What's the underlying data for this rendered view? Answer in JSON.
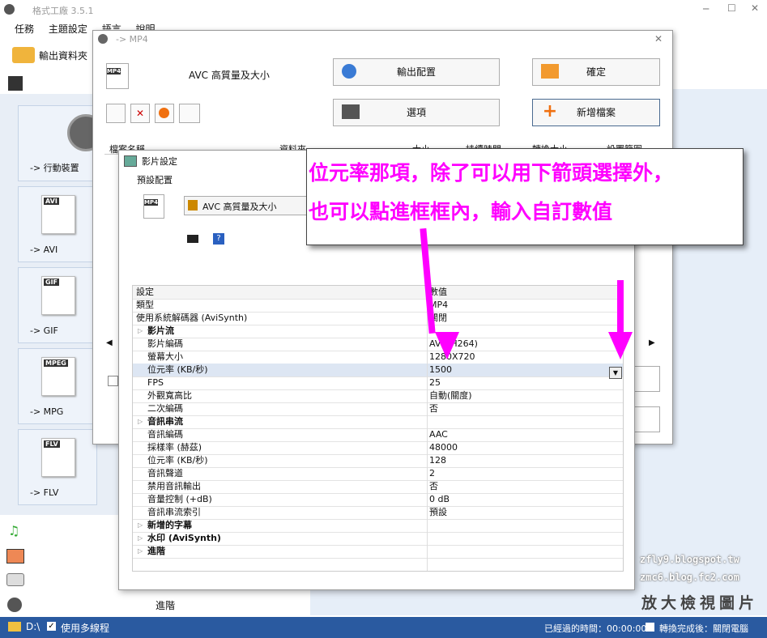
{
  "main_window": {
    "title": "格式工廠 3.5.1",
    "menu": [
      "任務",
      "主題設定",
      "語言",
      "說明"
    ],
    "output_folder_label": "輸出資料夾",
    "side_buttons": [
      {
        "label": "-> 行動裝置",
        "tag": ""
      },
      {
        "label": "-> AVI",
        "tag": "AVI"
      },
      {
        "label": "-> GIF",
        "tag": "GIF"
      },
      {
        "label": "-> MPG",
        "tag": "MPEG"
      },
      {
        "label": "-> FLV",
        "tag": "FLV"
      }
    ],
    "advanced_label": "進階",
    "status": {
      "drive": "D:\\",
      "multithread_label": "使用多線程",
      "elapsed_label": "已經過的時間：00:00:00",
      "after_convert_label": "轉換完成後：關閉電腦"
    }
  },
  "mp4_dialog": {
    "title": "-> MP4",
    "profile": "AVC 高質量及大小",
    "output_config_btn": "輸出配置",
    "ok_btn": "確定",
    "options_btn": "選項",
    "add_file_btn": "新增檔案",
    "mp4_tag": "MP4",
    "columns": [
      "檔案名稱",
      "資料夾",
      "大小",
      "持續時間",
      "轉換大小",
      "設置範圍"
    ]
  },
  "video_settings": {
    "title": "影片設定",
    "preset_label": "預設配置",
    "preset_value": "AVC 高質量及大小",
    "mp4_tag": "MP4",
    "help_glyph": "?",
    "header": {
      "name": "設定",
      "value": "數值"
    },
    "rows": [
      {
        "name": "類型",
        "value": "MP4",
        "kind": "item",
        "indent": 0
      },
      {
        "name": "使用系統解碼器 (AviSynth)",
        "value": "關閉",
        "kind": "item",
        "indent": 0
      },
      {
        "name": "影片流",
        "value": "",
        "kind": "cat",
        "indent": 0
      },
      {
        "name": "影片編碼",
        "value": "AVC(H264)",
        "kind": "item",
        "indent": 1
      },
      {
        "name": "螢幕大小",
        "value": "1280X720",
        "kind": "item",
        "indent": 1
      },
      {
        "name": "位元率 (KB/秒)",
        "value": "1500",
        "kind": "sel",
        "indent": 1
      },
      {
        "name": "FPS",
        "value": "25",
        "kind": "item",
        "indent": 1
      },
      {
        "name": "外觀寬高比",
        "value": "自動(關度)",
        "kind": "item",
        "indent": 1
      },
      {
        "name": "二次編碼",
        "value": "否",
        "kind": "item",
        "indent": 1
      },
      {
        "name": "音訊串流",
        "value": "",
        "kind": "cat",
        "indent": 0
      },
      {
        "name": "音訊編碼",
        "value": "AAC",
        "kind": "item",
        "indent": 1
      },
      {
        "name": "採樣率 (赫茲)",
        "value": "48000",
        "kind": "item",
        "indent": 1
      },
      {
        "name": "位元率 (KB/秒)",
        "value": "128",
        "kind": "item",
        "indent": 1
      },
      {
        "name": "音訊聲道",
        "value": "2",
        "kind": "item",
        "indent": 1
      },
      {
        "name": "禁用音訊輸出",
        "value": "否",
        "kind": "item",
        "indent": 1
      },
      {
        "name": "音量控制 (+dB)",
        "value": "0 dB",
        "kind": "item",
        "indent": 1
      },
      {
        "name": "音訊串流索引",
        "value": "預設",
        "kind": "item",
        "indent": 1
      },
      {
        "name": "新增的字幕",
        "value": "",
        "kind": "cat",
        "indent": 0
      },
      {
        "name": "水印 (AviSynth)",
        "value": "",
        "kind": "cat",
        "indent": 0
      },
      {
        "name": "進階",
        "value": "",
        "kind": "cat",
        "indent": 0
      }
    ]
  },
  "annotation": {
    "line1": "位元率那項，除了可以用下箭頭選擇外，",
    "line2": "也可以點進框框內，輸入自訂數值",
    "color": "#ff00ff"
  },
  "watermark": {
    "line1": "zfly9.blogspot.tw",
    "line2": "zmc6.blog.fc2.com",
    "line3": "放大檢視圖片"
  }
}
